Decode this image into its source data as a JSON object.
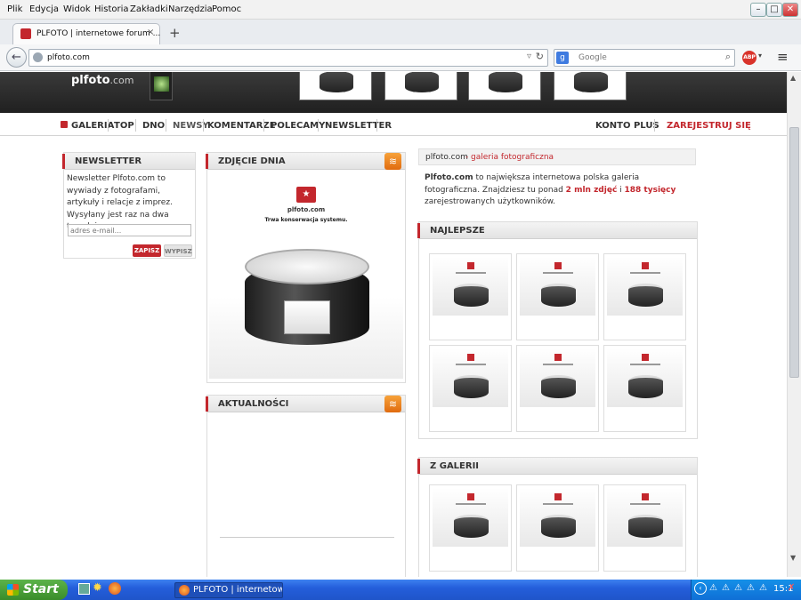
{
  "browser": {
    "menu": [
      "Plik",
      "Edycja",
      "Widok",
      "Historia",
      "Zakładki",
      "Narzędzia",
      "Pomoc"
    ],
    "tab_title": "PLFOTO | internetowe forum ...",
    "new_tab": "+",
    "url": "plfoto.com",
    "search_placeholder": "Google"
  },
  "site": {
    "logo": "plfoto",
    "logo_tld": ".com",
    "nav": [
      "GALERIA",
      "TOP",
      "DNO",
      "NEWSY",
      "KOMENTARZE",
      "POLECAMY",
      "NEWSLETTER"
    ],
    "nav_right": [
      "KONTO PLUS",
      "ZAREJESTRUJ SIĘ"
    ],
    "newsletter": {
      "title": "NEWSLETTER",
      "text": "Newsletter Plfoto.com to wywiady z fotografami, artykuły i relacje z imprez. Wysyłany jest raz na dwa tygodnie.",
      "placeholder": "adres e-mail...",
      "subscribe": "ZAPISZ",
      "unsubscribe": "WYPISZ"
    },
    "photo_of_day": {
      "title": "ZDJĘCIE DNIA",
      "logo": "plfoto.com",
      "maintenance": "Trwa konserwacja systemu."
    },
    "news": {
      "title": "AKTUALNOŚCI"
    },
    "intro": {
      "site": "plfoto.com",
      "dash": " - ",
      "tag": "galeria fotograficzna",
      "brand": "Plfoto.com",
      "p1": " to największa internetowa polska galeria fotograficzna. Znajdziesz tu ponad ",
      "n1": "2 mln zdjęć",
      "p2": " i ",
      "n2": "188 tysięcy",
      "p3": " zarejestrowanych użytkowników."
    },
    "best": {
      "title": "NAJLEPSZE"
    },
    "from_gallery": {
      "title": "Z GALERII"
    }
  },
  "taskbar": {
    "start": "Start",
    "task": "PLFOTO | internetow...",
    "clock": "15:1"
  }
}
